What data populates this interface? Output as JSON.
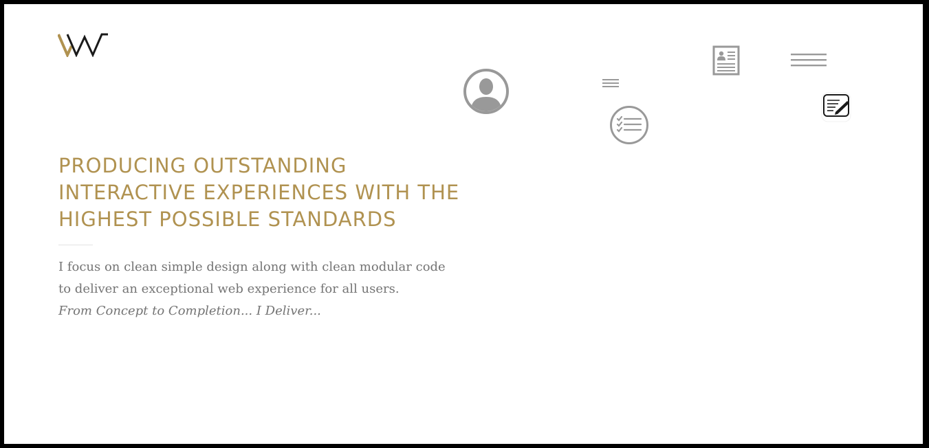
{
  "brand": {
    "logo_icon": "vw-monogram",
    "colors": {
      "gold": "#b09250",
      "dark": "#1a1a1a",
      "icon_gray": "#999999"
    }
  },
  "nav": {
    "icons": [
      "user-icon",
      "menu-lines-icon",
      "checklist-icon",
      "resume-icon",
      "hamburger-icon",
      "edit-note-icon"
    ]
  },
  "hero": {
    "headline_lines": [
      "PRODUCING OUTSTANDING",
      "INTERACTIVE EXPERIENCES WITH THE",
      "HIGHEST POSSIBLE STANDARDS"
    ],
    "intro_lines": [
      "I focus on clean simple design along with clean modular code",
      "to deliver an exceptional web experience for all users."
    ],
    "tagline": "From Concept to Completion... I Deliver..."
  }
}
